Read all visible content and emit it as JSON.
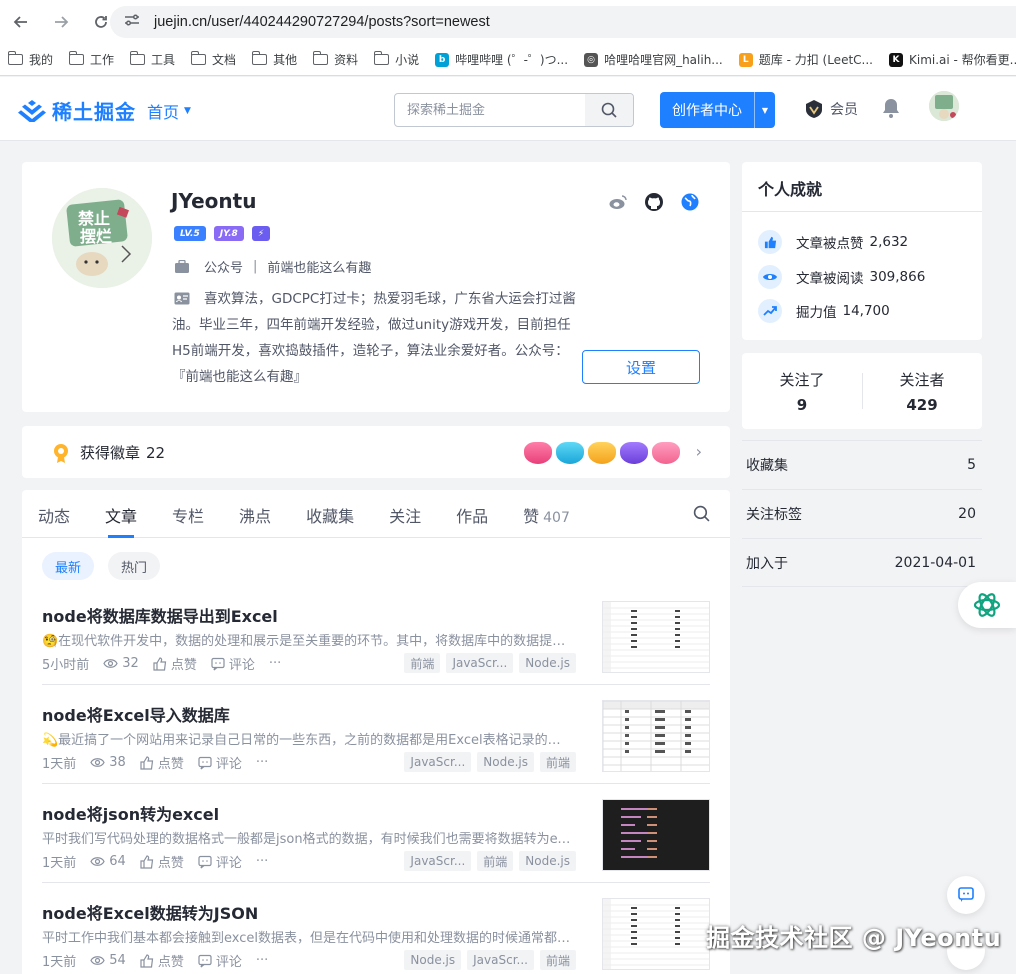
{
  "browser": {
    "url": "juejin.cn/user/440244290727294/posts?sort=newest",
    "bookmarks": [
      {
        "label": "我的",
        "type": "folder"
      },
      {
        "label": "工作",
        "type": "folder"
      },
      {
        "label": "工具",
        "type": "folder"
      },
      {
        "label": "文档",
        "type": "folder"
      },
      {
        "label": "其他",
        "type": "folder"
      },
      {
        "label": "资料",
        "type": "folder"
      },
      {
        "label": "小说",
        "type": "folder"
      },
      {
        "label": "哔哩哔哩 (゜-゜)つ...",
        "type": "site",
        "color": "#00a1d6",
        "glyph": "b"
      },
      {
        "label": "哈哩哈哩官网_halih...",
        "type": "site",
        "color": "#555555",
        "glyph": "◎"
      },
      {
        "label": "题库 - 力扣 (LeetC...",
        "type": "site",
        "color": "#f89f1b",
        "glyph": "L"
      },
      {
        "label": "Kimi.ai - 帮你看更...",
        "type": "site",
        "color": "#111111",
        "glyph": "K"
      }
    ]
  },
  "header": {
    "logo_text": "稀土掘金",
    "home_nav": "首页",
    "search_placeholder": "探索稀土掘金",
    "creator_button": "创作者中心",
    "vip_label": "会员"
  },
  "profile": {
    "username": "JYeontu",
    "level_badges": [
      {
        "text": "LV.5",
        "color": "#3b80ff"
      },
      {
        "text": "JY.8",
        "color": "#8a6bf5"
      },
      {
        "text": "⚡",
        "color": "#6b5df0"
      }
    ],
    "job_label": "公众号",
    "job_separator": "|",
    "company": "前端也能这么有趣",
    "bio": "喜欢算法，GDCPC打过卡；热爱羽毛球，广东省大运会打过酱油。毕业三年，四年前端开发经验，做过unity游戏开发，目前担任H5前端开发，喜欢捣鼓插件，造轮子，算法业余爱好者。公众号：『前端也能这么有趣』",
    "settings_button": "设置",
    "avatar_text": "禁止摆烂"
  },
  "medals": {
    "label": "获得徽章",
    "count": "22"
  },
  "feed": {
    "tabs": [
      {
        "label": "动态",
        "count": ""
      },
      {
        "label": "文章",
        "count": ""
      },
      {
        "label": "专栏",
        "count": ""
      },
      {
        "label": "沸点",
        "count": ""
      },
      {
        "label": "收藏集",
        "count": ""
      },
      {
        "label": "关注",
        "count": ""
      },
      {
        "label": "作品",
        "count": ""
      },
      {
        "label": "赞",
        "count": "407"
      }
    ],
    "active_tab": "文章",
    "sort_chips": [
      "最新",
      "热门"
    ],
    "articles": [
      {
        "title": "node将数据库数据导出到Excel",
        "abstract": "🧐在现代软件开发中，数据的处理和展示是至关重要的环节。其中，将数据库中的数据提取并导出到Excel...",
        "time": "5小时前",
        "views": "32",
        "like_label": "点赞",
        "comment_label": "评论",
        "tags": [
          "前端",
          "JavaScr...",
          "Node.js"
        ]
      },
      {
        "title": "node将Excel导入数据库",
        "abstract": "💫最近搞了一个网站用来记录自己日常的一些东西，之前的数据都是用Excel表格记录的，现在需要导入数据库",
        "time": "1天前",
        "views": "38",
        "like_label": "点赞",
        "comment_label": "评论",
        "tags": [
          "JavaScr...",
          "Node.js",
          "前端"
        ]
      },
      {
        "title": "node将json转为excel",
        "abstract": "平时我们写代码处理的数据格式一般都是json格式的数据，有时候我们也需要将数据转为excel表格",
        "time": "1天前",
        "views": "64",
        "like_label": "点赞",
        "comment_label": "评论",
        "tags": [
          "JavaScr...",
          "前端",
          "Node.js"
        ]
      },
      {
        "title": "node将Excel数据转为JSON",
        "abstract": "平时工作中我们基本都会接触到excel数据表，但是在代码中使用和处理数据的时候通常都是使用json格式",
        "time": "1天前",
        "views": "54",
        "like_label": "点赞",
        "comment_label": "评论",
        "tags": [
          "Node.js",
          "JavaScr...",
          "前端"
        ]
      }
    ]
  },
  "achievements": {
    "title": "个人成就",
    "likes_label": "文章被点赞",
    "likes": "2,632",
    "reads_label": "文章被阅读",
    "reads": "309,866",
    "power_label": "掘力值",
    "power": "14,700"
  },
  "follow": {
    "following_label": "关注了",
    "following": "9",
    "followers_label": "关注者",
    "followers": "429"
  },
  "stats": [
    {
      "label": "收藏集",
      "value": "5"
    },
    {
      "label": "关注标签",
      "value": "20"
    },
    {
      "label": "加入于",
      "value": "2021-04-01"
    }
  ],
  "watermark": "掘金技术社区 @ JYeontu",
  "colors": {
    "brand": "#1e80ff",
    "page_bg": "#f2f3f5"
  }
}
